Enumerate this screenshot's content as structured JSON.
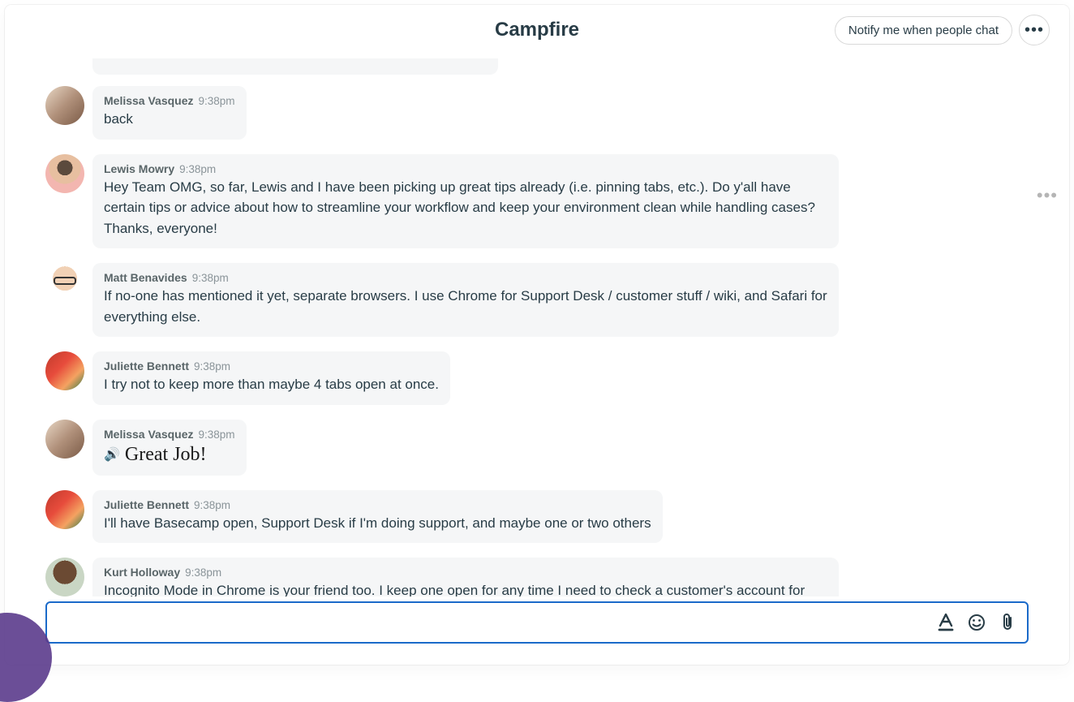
{
  "header": {
    "title": "Campfire",
    "notify_label": "Notify me when people chat"
  },
  "messages": [
    {
      "author": "Melissa Vasquez",
      "time": "9:38pm",
      "text": "back",
      "avatar": "melissa",
      "kind": "text"
    },
    {
      "author": "Lewis Mowry",
      "time": "9:38pm",
      "text": "Hey Team OMG, so far, Lewis and I have been picking up great tips already (i.e. pinning tabs, etc.). Do y'all have certain tips or advice about how to streamline your workflow and keep your environment clean while handling cases? Thanks, everyone!",
      "avatar": "lewis",
      "kind": "text",
      "show_hover": true
    },
    {
      "author": "Matt Benavides",
      "time": "9:38pm",
      "text": "If no-one has mentioned it yet, separate browsers. I use Chrome for Support Desk / customer stuff / wiki, and Safari for everything else.",
      "avatar": "matt",
      "kind": "text"
    },
    {
      "author": "Juliette Bennett",
      "time": "9:38pm",
      "text": "I try not to keep more than maybe 4 tabs open at once.",
      "avatar": "juliette",
      "kind": "text"
    },
    {
      "author": "Melissa Vasquez",
      "time": "9:38pm",
      "text": "Great Job!",
      "avatar": "melissa",
      "kind": "sound"
    },
    {
      "author": "Juliette Bennett",
      "time": "9:38pm",
      "text": "I'll have Basecamp open, Support Desk if I'm doing support, and maybe one or two others",
      "avatar": "juliette",
      "kind": "text"
    },
    {
      "author": "Kurt Holloway",
      "time": "9:38pm",
      "text": "Incognito Mode in Chrome is your friend too. I keep one open for any time I need to check a customer's account for something.",
      "avatar": "kurt",
      "kind": "text"
    }
  ],
  "composer": {
    "placeholder": ""
  }
}
